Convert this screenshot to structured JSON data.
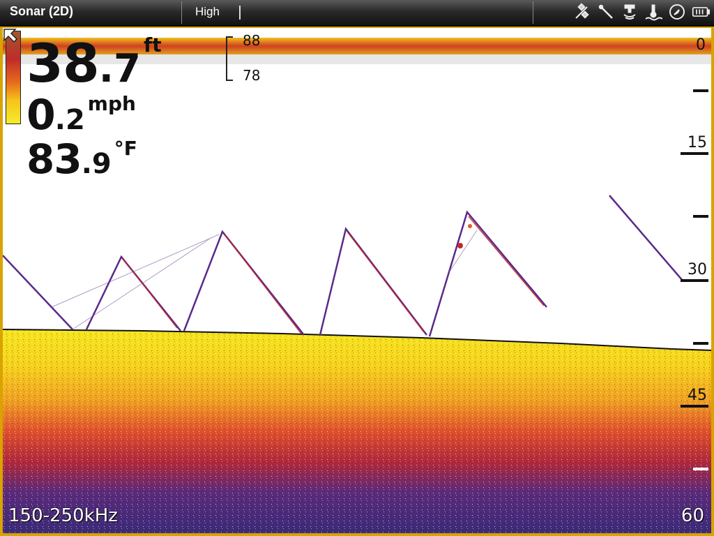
{
  "topbar": {
    "title": "Sonar (2D)",
    "mode": "High",
    "icons": [
      "satellite-icon",
      "gps-antenna-icon",
      "transducer-icon",
      "water-temp-icon",
      "compass-icon",
      "battery-icon"
    ]
  },
  "readouts": {
    "depth_whole": "38",
    "depth_decimal": ".7",
    "depth_unit": "ft",
    "speed_whole": "0",
    "speed_decimal": ".2",
    "speed_unit": "mph",
    "temp_whole": "83",
    "temp_decimal": ".9",
    "temp_unit": "°F"
  },
  "range_bracket": {
    "high": "88",
    "low": "78"
  },
  "depth_scale": {
    "labels": [
      "0",
      "15",
      "30",
      "45"
    ],
    "bottom": "60"
  },
  "frequency": "150-250kHz",
  "colors": {
    "frame": "#d9a300",
    "bottom_yellow": "#f6e61d",
    "return_red": "#c0282b",
    "return_purple": "#3a1f7a"
  }
}
